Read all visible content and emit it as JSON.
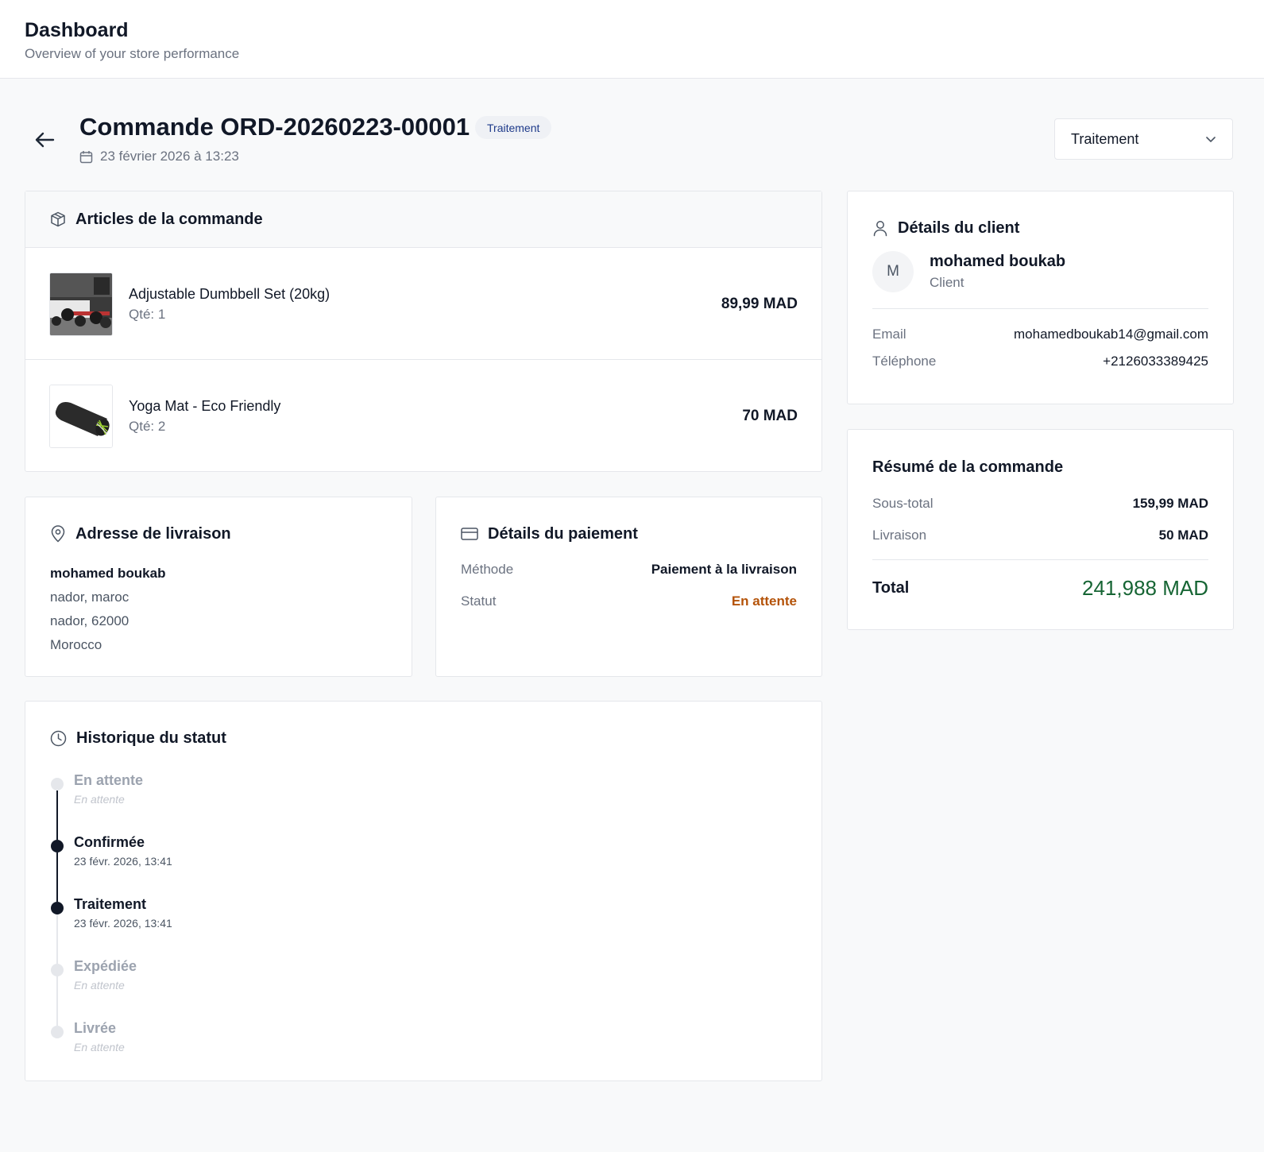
{
  "header": {
    "title": "Dashboard",
    "subtitle": "Overview of your store performance"
  },
  "order": {
    "title": "Commande ORD-20260223-00001",
    "status_badge": "Traitement",
    "date": "23 février 2026 à 13:23",
    "status_select": "Traitement"
  },
  "items_card": {
    "title": "Articles de la commande",
    "items": [
      {
        "name": "Adjustable Dumbbell Set (20kg)",
        "qty": "Qté: 1",
        "price": "89,99 MAD"
      },
      {
        "name": "Yoga Mat - Eco Friendly",
        "qty": "Qté: 2",
        "price": "70 MAD"
      }
    ]
  },
  "shipping": {
    "title": "Adresse de livraison",
    "name": "mohamed boukab",
    "line1": "nador, maroc",
    "line2": "nador, 62000",
    "country": "Morocco"
  },
  "payment": {
    "title": "Détails du paiement",
    "method_label": "Méthode",
    "method_value": "Paiement à la livraison",
    "status_label": "Statut",
    "status_value": "En attente"
  },
  "history": {
    "title": "Historique du statut",
    "steps": [
      {
        "title": "En attente",
        "sub": "En attente",
        "state": "todo"
      },
      {
        "title": "Confirmée",
        "sub": "23 févr. 2026, 13:41",
        "state": "done"
      },
      {
        "title": "Traitement",
        "sub": "23 févr. 2026, 13:41",
        "state": "done"
      },
      {
        "title": "Expédiée",
        "sub": "En attente",
        "state": "todo"
      },
      {
        "title": "Livrée",
        "sub": "En attente",
        "state": "todo"
      }
    ]
  },
  "client": {
    "title": "Détails du client",
    "avatar_initial": "M",
    "name": "mohamed boukab",
    "role": "Client",
    "email_label": "Email",
    "email_value": "mohamedboukab14@gmail.com",
    "phone_label": "Téléphone",
    "phone_value": "+2126033389425"
  },
  "summary": {
    "title": "Résumé de la commande",
    "subtotal_label": "Sous-total",
    "subtotal_value": "159,99 MAD",
    "shipping_label": "Livraison",
    "shipping_value": "50 MAD",
    "total_label": "Total",
    "total_value": "241,988 MAD"
  },
  "colors": {
    "accent_dark": "#111827",
    "status_pending": "#b45309",
    "total_green": "#166534",
    "pill_text": "#1e3a8a"
  }
}
